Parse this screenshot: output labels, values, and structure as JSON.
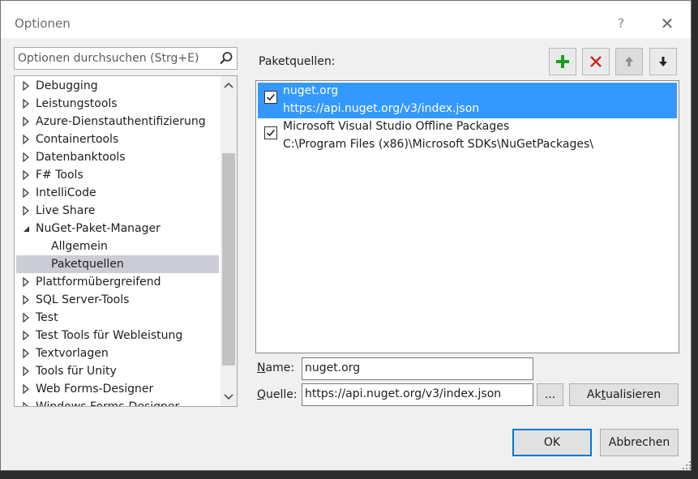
{
  "window": {
    "title": "Optionen",
    "help_label": "?",
    "close_label": "✕"
  },
  "search": {
    "placeholder": "Optionen durchsuchen (Strg+E)",
    "icon": "search-icon"
  },
  "tree": {
    "items": [
      {
        "label": "Debugging",
        "expanded": false,
        "level": 0
      },
      {
        "label": "Leistungstools",
        "expanded": false,
        "level": 0
      },
      {
        "label": "Azure-Dienstauthentifizierung",
        "expanded": false,
        "level": 0
      },
      {
        "label": "Containertools",
        "expanded": false,
        "level": 0
      },
      {
        "label": "Datenbanktools",
        "expanded": false,
        "level": 0
      },
      {
        "label": "F# Tools",
        "expanded": false,
        "level": 0
      },
      {
        "label": "IntelliCode",
        "expanded": false,
        "level": 0
      },
      {
        "label": "Live Share",
        "expanded": false,
        "level": 0
      },
      {
        "label": "NuGet-Paket-Manager",
        "expanded": true,
        "level": 0
      },
      {
        "label": "Allgemein",
        "level": 1
      },
      {
        "label": "Paketquellen",
        "level": 1,
        "selected": true
      },
      {
        "label": "Plattformübergreifend",
        "expanded": false,
        "level": 0
      },
      {
        "label": "SQL Server-Tools",
        "expanded": false,
        "level": 0
      },
      {
        "label": "Test",
        "expanded": false,
        "level": 0
      },
      {
        "label": "Test Tools für Webleistung",
        "expanded": false,
        "level": 0
      },
      {
        "label": "Textvorlagen",
        "expanded": false,
        "level": 0
      },
      {
        "label": "Tools für Unity",
        "expanded": false,
        "level": 0
      },
      {
        "label": "Web Forms-Designer",
        "expanded": false,
        "level": 0
      },
      {
        "label": "Windows Forms-Designer",
        "expanded": false,
        "level": 0
      }
    ]
  },
  "package_sources": {
    "label": "Paketquellen:",
    "toolbar": {
      "add_icon": "plus-icon",
      "remove_icon": "x-icon",
      "up_icon": "arrow-up-icon",
      "down_icon": "arrow-down-icon"
    },
    "items": [
      {
        "name": "nuget.org",
        "url": "https://api.nuget.org/v3/index.json",
        "checked": true,
        "selected": true
      },
      {
        "name": "Microsoft Visual Studio Offline Packages",
        "url": "C:\\Program Files (x86)\\Microsoft SDKs\\NuGetPackages\\",
        "checked": true,
        "selected": false
      }
    ]
  },
  "form": {
    "name_label_u": "N",
    "name_label_rest": "ame:",
    "name_value": "nuget.org",
    "source_label_u": "Q",
    "source_label_rest": "uelle:",
    "source_value": "https://api.nuget.org/v3/index.json",
    "browse_label": "...",
    "update_label_pre": "Ak",
    "update_label_u": "t",
    "update_label_post": "ualisieren"
  },
  "footer": {
    "ok_label": "OK",
    "cancel_label": "Abbrechen"
  },
  "colors": {
    "selection": "#3399ff",
    "tree_selection": "#ccccd6",
    "add_green": "#1e9e1e",
    "remove_red": "#c42b1c"
  }
}
